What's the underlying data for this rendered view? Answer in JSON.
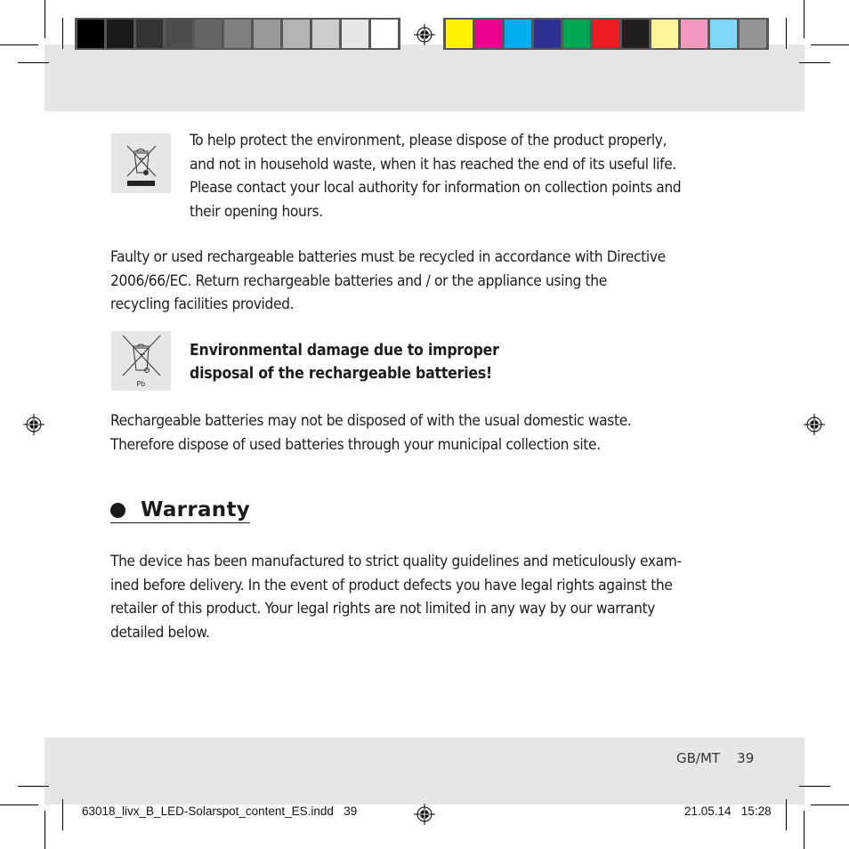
{
  "print_marks": {
    "gray_swatches": [
      "#000000",
      "#1a1a1a",
      "#333333",
      "#4d4d4d",
      "#666666",
      "#808080",
      "#999999",
      "#b3b3b3",
      "#cccccc",
      "#e6e6e6",
      "#ffffff"
    ],
    "color_swatches": [
      "#fff200",
      "#ec008c",
      "#00aeef",
      "#2e3192",
      "#00a651",
      "#ed1c24",
      "#231f20",
      "#fff799",
      "#f49ac1",
      "#7dd8f7",
      "#939598"
    ]
  },
  "content": {
    "weee_paragraph": [
      "To help protect the environment, please dispose of the product properly,",
      "and not in household waste, when it has reached the end of its useful life.",
      "Please contact your local authority for information on collection points and",
      "their opening hours."
    ],
    "battery_paragraph": [
      "Faulty or used rechargeable batteries must be recycled in accordance with Directive",
      "2006/66/EC. Return rechargeable batteries and / or the appliance using the",
      "recycling facilities provided."
    ],
    "battery_icon_label": "Pb",
    "warning": [
      "Environmental damage due to improper",
      "disposal of the rechargeable batteries!"
    ],
    "disposal_paragraph": [
      "Rechargeable batteries may not be disposed of with the usual domestic waste.",
      "Therefore dispose of used batteries through your municipal collection site."
    ],
    "warranty_heading": "Warranty",
    "warranty_paragraph": [
      "The device has been manufactured to strict quality guidelines and meticulously exam-",
      "ined before delivery. In the event of product defects you have legal rights against the",
      "retailer of this product. Your legal rights are not limited in any way by our warranty",
      "detailed below."
    ]
  },
  "footer": {
    "page_label": "GB/MT    39",
    "slug_file": "63018_livx_B_LED-Solarspot_content_ES.indd   39",
    "slug_date": "21.05.14   15:28"
  }
}
